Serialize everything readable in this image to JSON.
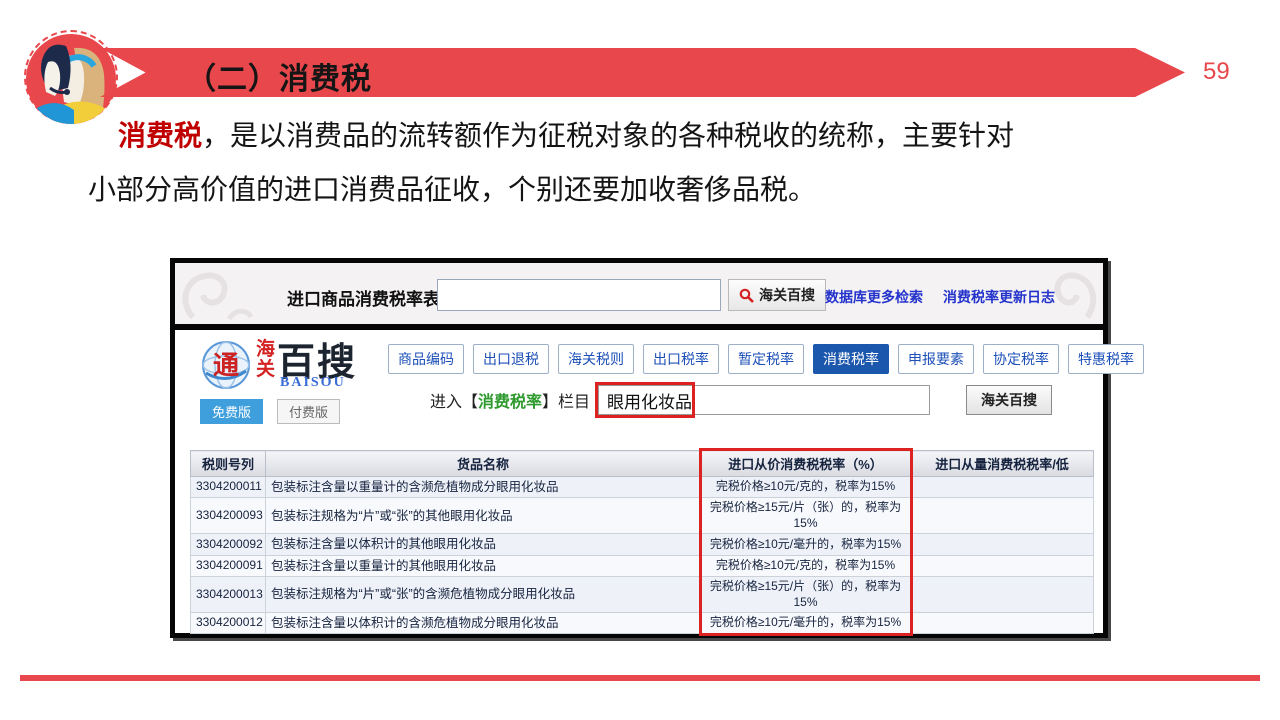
{
  "slide": {
    "title": "（二）消费税",
    "page_number": "59",
    "paragraph": {
      "lead": "消费税",
      "line1_rest": "，是以消费品的流转额作为征税对象的各种税收的统称，主要针对",
      "line2": "小部分高价值的进口消费品征收，个别还要加收奢侈品税。"
    },
    "accent_color": "#e8474b",
    "lead_color": "#c00000"
  },
  "site": {
    "topbar": {
      "label": "进口商品消费税率表",
      "search_value": "",
      "search_button": "海关百搜",
      "search_icon": "magnifier-icon",
      "links": {
        "0": "数据库更多检索",
        "1": "消费税率更新日志"
      }
    },
    "logo": {
      "seal_char": "通",
      "vertical_line1": "海",
      "vertical_line2": "关",
      "main_text": "百搜",
      "sub_text": "BAISOU",
      "free_button": "免费版",
      "paid_button": "付费版"
    },
    "nav": {
      "items": [
        "商品编码",
        "出口退税",
        "海关税则",
        "出口税率",
        "暂定税率",
        "消费税率",
        "申报要素",
        "协定税率",
        "特惠税率"
      ],
      "active": "消费税率"
    },
    "search_row": {
      "prefix": "进入【",
      "highlight": "消费税率",
      "suffix": "】栏目",
      "input_value": "眼用化妆品",
      "button": "海关百搜"
    }
  },
  "table": {
    "headers": [
      "税则号列",
      "货品名称",
      "进口从价消费税税率（%）",
      "进口从量消费税税率/低"
    ],
    "rows": [
      {
        "code": "3304200011",
        "name": "包装标注含量以重量计的含濒危植物成分眼用化妆品",
        "ad_valorem": "完税价格≥10元/克的，税率为15%",
        "specific": ""
      },
      {
        "code": "3304200093",
        "name": "包装标注规格为“片”或“张”的其他眼用化妆品",
        "ad_valorem": "完税价格≥15元/片（张）的，税率为15%",
        "specific": ""
      },
      {
        "code": "3304200092",
        "name": "包装标注含量以体积计的其他眼用化妆品",
        "ad_valorem": "完税价格≥10元/毫升的，税率为15%",
        "specific": ""
      },
      {
        "code": "3304200091",
        "name": "包装标注含量以重量计的其他眼用化妆品",
        "ad_valorem": "完税价格≥10元/克的，税率为15%",
        "specific": ""
      },
      {
        "code": "3304200013",
        "name": "包装标注规格为“片”或“张”的含濒危植物成分眼用化妆品",
        "ad_valorem": "完税价格≥15元/片（张）的，税率为15%",
        "specific": ""
      },
      {
        "code": "3304200012",
        "name": "包装标注含量以体积计的含濒危植物成分眼用化妆品",
        "ad_valorem": "完税价格≥10元/毫升的，税率为15%",
        "specific": ""
      }
    ]
  }
}
